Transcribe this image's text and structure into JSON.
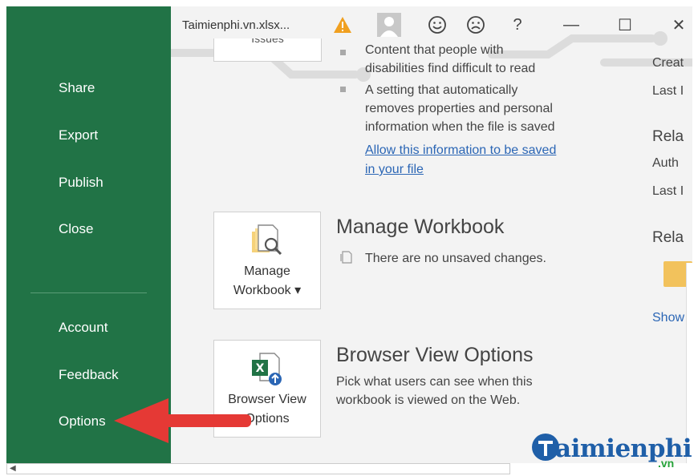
{
  "window": {
    "title": "Taimienphi.vn.xlsx...",
    "warning_icon": "warning-icon",
    "minimize": "—",
    "maximize": "☐",
    "close": "✕",
    "help": "?"
  },
  "nav": {
    "items": [
      {
        "label": "Share"
      },
      {
        "label": "Export"
      },
      {
        "label": "Publish"
      },
      {
        "label": "Close"
      },
      {
        "label": "Account"
      },
      {
        "label": "Feedback"
      },
      {
        "label": "Options"
      }
    ]
  },
  "inspect": {
    "issues_label": "Issues",
    "bullet1": [
      "Content that people with",
      "disabilities find difficult to read"
    ],
    "bullet2": [
      "A setting that automatically",
      "removes properties and personal",
      "information when the file is saved"
    ],
    "link": [
      "Allow this information to be saved",
      "in your file"
    ]
  },
  "manage": {
    "button_line1": "Manage",
    "button_line2": "Workbook ▾",
    "title": "Manage Workbook",
    "status": "There are no unsaved changes."
  },
  "browser": {
    "button_line1": "Browser View",
    "button_line2": "Options",
    "title": "Browser View Options",
    "desc": [
      "Pick what users can see when this",
      "workbook is viewed on the Web."
    ]
  },
  "properties": {
    "created": "Creat",
    "last1": "Last I",
    "related_dates": "Rela",
    "author": "Auth",
    "last2": "Last I",
    "related_docs": "Rela",
    "show": "Show"
  },
  "brand": {
    "name": "aimienphi",
    "tld": ".vn"
  },
  "colors": {
    "nav_bg": "#217346",
    "link": "#2b66b5",
    "arrow": "#e53935"
  }
}
